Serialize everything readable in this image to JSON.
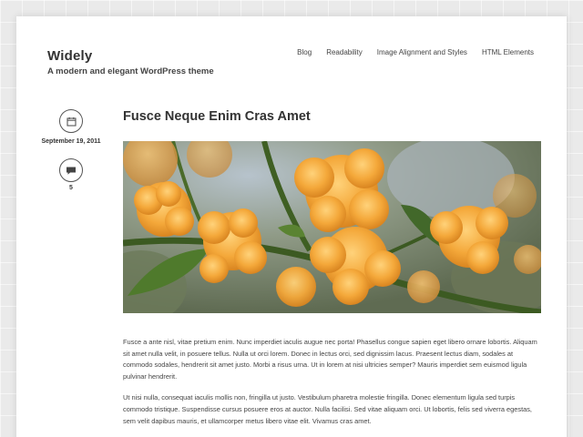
{
  "site": {
    "title": "Widely",
    "description": "A modern and elegant WordPress theme"
  },
  "nav": {
    "items": [
      {
        "label": "Blog"
      },
      {
        "label": "Readability"
      },
      {
        "label": "Image Alignment and Styles"
      },
      {
        "label": "HTML Elements"
      }
    ]
  },
  "post": {
    "title": "Fusce Neque Enim Cras Amet",
    "date": "September 19, 2011",
    "comment_count": "5",
    "date_icon": "calendar-icon",
    "comment_icon": "speech-bubble-icon",
    "paragraphs": [
      "Fusce a ante nisl, vitae pretium enim. Nunc imperdiet iaculis augue nec porta! Phasellus congue sapien eget libero ornare lobortis. Aliquam sit amet nulla velit, in posuere tellus. Nulla ut orci lorem. Donec in lectus orci, sed dignissim lacus. Praesent lectus diam, sodales at commodo sodales, hendrerit sit amet justo. Morbi a risus urna. Ut in lorem at nisi ultricies semper? Mauris imperdiet sem euismod ligula pulvinar hendrerit.",
      "Ut nisi nulla, consequat iaculis mollis non, fringilla ut justo. Vestibulum pharetra molestie fringilla. Donec elementum ligula sed turpis commodo tristique. Suspendisse cursus posuere eros at auctor. Nulla facilisi. Sed vitae aliquam orci. Ut lobortis, felis sed viverra egestas, sem velit dapibus mauris, et ullamcorper metus libero vitae elit. Vivamus cras amet."
    ]
  },
  "colors": {
    "background": "#eaeaea",
    "page": "#ffffff",
    "text": "#333333",
    "flower": "#f2a43a"
  }
}
